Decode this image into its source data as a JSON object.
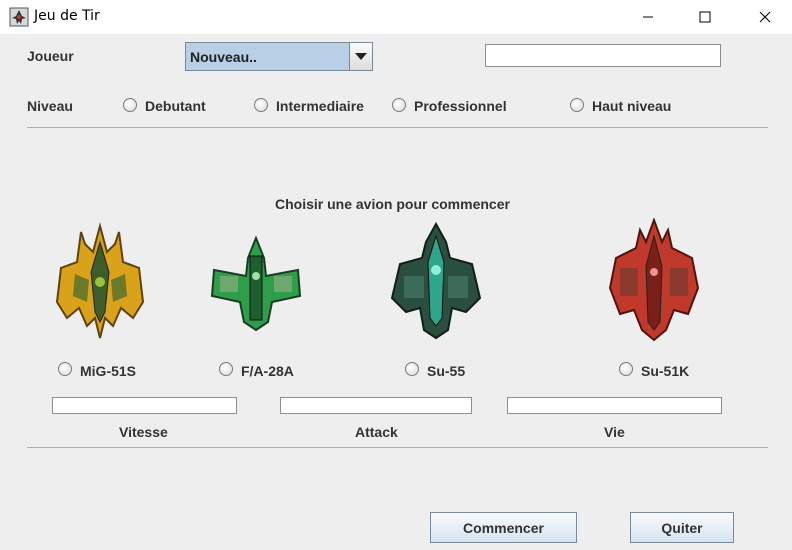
{
  "window": {
    "title": "Jeu de Tir"
  },
  "player": {
    "label": "Joueur",
    "selected": "Nouveau..",
    "name_value": ""
  },
  "level": {
    "label": "Niveau",
    "options": [
      "Debutant",
      "Intermediaire",
      "Professionnel",
      "Haut niveau"
    ]
  },
  "prompt": "Choisir une avion pour commencer",
  "planes": [
    {
      "name": "MiG-51S",
      "color": "#d9a21a"
    },
    {
      "name": "F/A-28A",
      "color": "#2f9e4a"
    },
    {
      "name": "Su-55",
      "color": "#2fa58a"
    },
    {
      "name": "Su-51K",
      "color": "#c0392b"
    }
  ],
  "stats": {
    "speed": "Vitesse",
    "attack": "Attack",
    "life": "Vie"
  },
  "buttons": {
    "start": "Commencer",
    "quit": "Quiter"
  }
}
